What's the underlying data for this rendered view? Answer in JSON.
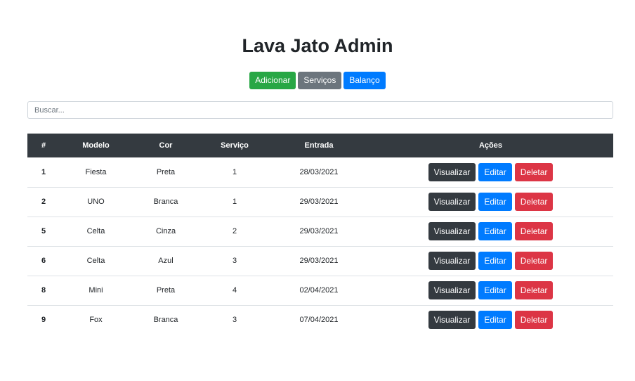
{
  "page": {
    "title": "Lava Jato Admin"
  },
  "toolbar": {
    "add_label": "Adicionar",
    "services_label": "Serviços",
    "balance_label": "Balanço"
  },
  "search": {
    "placeholder": "Buscar...",
    "value": ""
  },
  "table": {
    "headers": [
      "#",
      "Modelo",
      "Cor",
      "Serviço",
      "Entrada",
      "Ações"
    ],
    "rows": [
      {
        "id": "1",
        "modelo": "Fiesta",
        "cor": "Preta",
        "servico": "1",
        "entrada": "28/03/2021"
      },
      {
        "id": "2",
        "modelo": "UNO",
        "cor": "Branca",
        "servico": "1",
        "entrada": "29/03/2021"
      },
      {
        "id": "5",
        "modelo": "Celta",
        "cor": "Cinza",
        "servico": "2",
        "entrada": "29/03/2021"
      },
      {
        "id": "6",
        "modelo": "Celta",
        "cor": "Azul",
        "servico": "3",
        "entrada": "29/03/2021"
      },
      {
        "id": "8",
        "modelo": "Mini",
        "cor": "Preta",
        "servico": "4",
        "entrada": "02/04/2021"
      },
      {
        "id": "9",
        "modelo": "Fox",
        "cor": "Branca",
        "servico": "3",
        "entrada": "07/04/2021"
      }
    ],
    "actions": {
      "view": "Visualizar",
      "edit": "Editar",
      "delete": "Deletar"
    }
  },
  "colors": {
    "success": "#28a745",
    "secondary": "#6c757d",
    "primary": "#007bff",
    "dark": "#343a40",
    "danger": "#dc3545"
  }
}
